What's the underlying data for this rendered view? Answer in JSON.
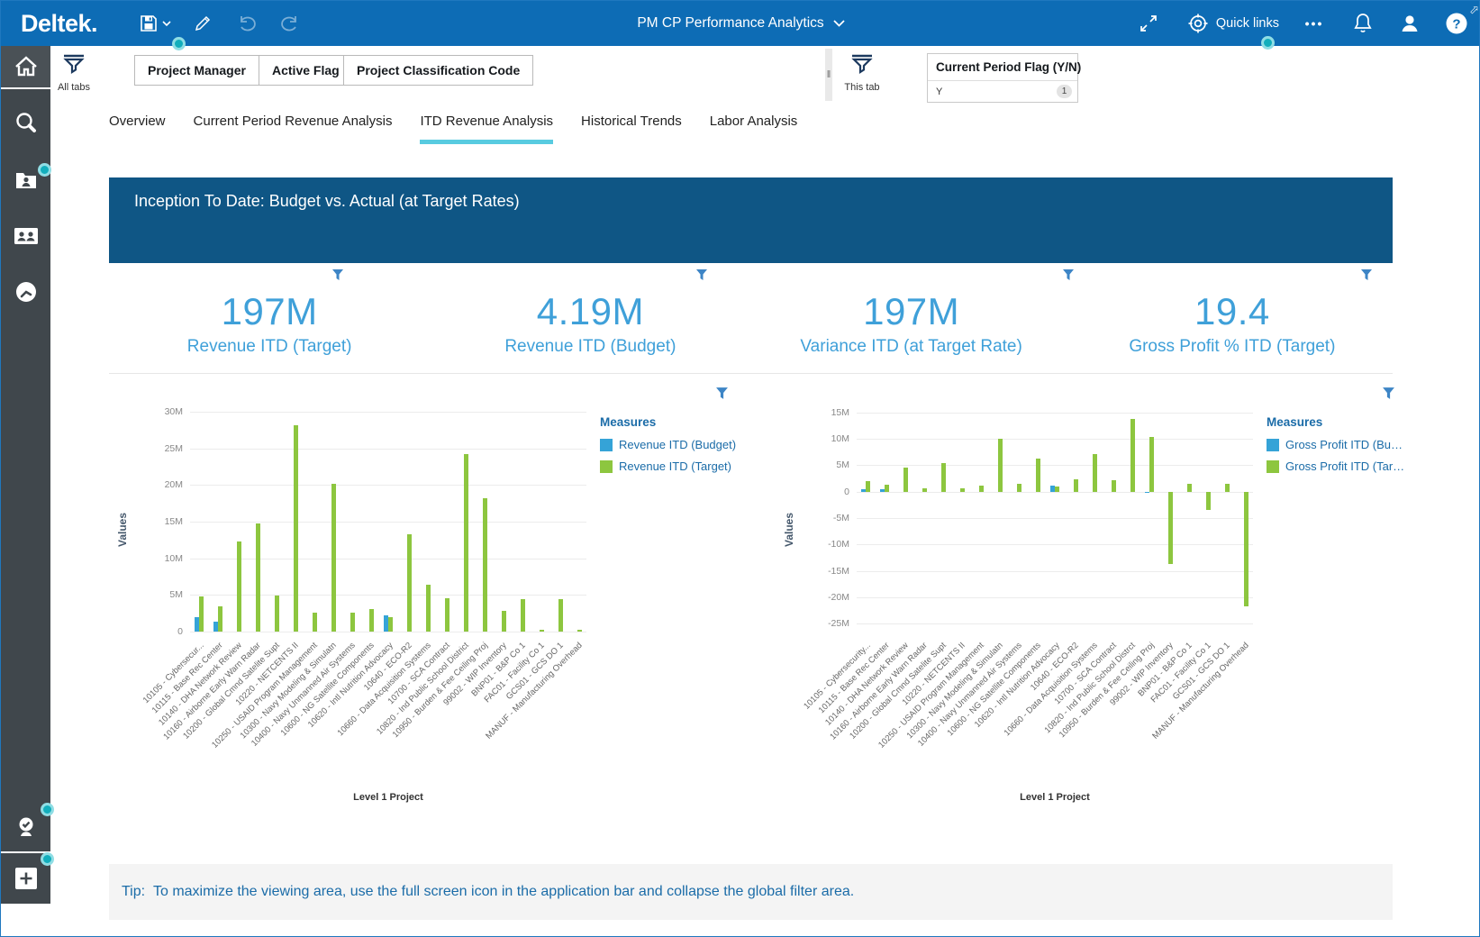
{
  "header": {
    "logo": "Deltek.",
    "title": "PM CP Performance Analytics",
    "quick_links_label": "Quick links",
    "ellipsis_glyph": "•••"
  },
  "filters": {
    "all_tabs_label": "All tabs",
    "this_tab_label": "This tab",
    "buttons": [
      "Project Manager",
      "Active Flag",
      "Project Classification Code"
    ],
    "current_period": {
      "title": "Current Period Flag (Y/N)",
      "value": "Y",
      "count": "1"
    }
  },
  "tabs": [
    "Overview",
    "Current Period Revenue Analysis",
    "ITD Revenue Analysis",
    "Historical Trends",
    "Labor Analysis"
  ],
  "banner": {
    "title": "Inception To Date:  Budget vs. Actual (at Target Rates)"
  },
  "kpis": [
    {
      "value": "197M",
      "label": "Revenue ITD (Target)"
    },
    {
      "value": "4.19M",
      "label": "Revenue ITD (Budget)"
    },
    {
      "value": "197M",
      "label": "Variance ITD (at Target Rate)"
    },
    {
      "value": "19.4",
      "label": "Gross Profit % ITD (Target)"
    }
  ],
  "tip": {
    "prefix": "Tip:",
    "text": "To maximize the viewing area, use the full screen icon in the application bar and collapse the global filter area."
  },
  "colors": {
    "header_blue": "#0d6cb5",
    "banner_blue": "#0f5685",
    "accent_cyan": "#58cbe0",
    "kpi_blue": "#3fa0d9",
    "legend_blue": "#1b6ca8",
    "bar_green": "#8dc63f",
    "bar_blue": "#35a3d7",
    "sidebar_gray": "#40474c",
    "hint_teal": "#12aebc"
  },
  "chart_data": [
    {
      "type": "bar",
      "legend_title": "Measures",
      "legend_position": "right",
      "xlabel": "Level 1 Project",
      "ylabel": "Values",
      "ylim": [
        0,
        31
      ],
      "yticks": [
        0,
        5,
        10,
        15,
        20,
        25,
        30
      ],
      "grid": true,
      "categories": [
        "10105 - Cybersecur...",
        "10115 - Base Rec Center",
        "10140 - DHA Network Review",
        "10160 - Airborne Early Warn Radar",
        "10200 - Global Cmnd Satelite Supt",
        "10220 - NETCENTS II",
        "10250 - USAID Program Management",
        "10300 - Navy Modeling & Simulatn",
        "10400 - Navy Unmanned Air Systems",
        "10600 - NG Satellite Components",
        "10620 - Intl Nutrition Advocacy",
        "10640 - ECO-R2",
        "10660 - Data Acquisition Systems",
        "10700 - SCA Contract",
        "10820 - Ind Public School District",
        "10950 - Burden & Fee Ceiling Proj",
        "99002 - WIP Inventory",
        "BNP01 - B&P Co 1",
        "FAC01 - Facility Co 1",
        "GCS01 - GCS DO 1",
        "MANUF - Manufacturing Overhead"
      ],
      "series": [
        {
          "name": "Revenue ITD (Budget)",
          "color": "#35a3d7",
          "values": [
            2.0,
            1.3,
            0,
            0,
            0,
            0,
            0,
            0,
            0,
            0,
            2.2,
            0,
            0,
            0,
            0,
            0,
            0,
            0,
            0,
            0,
            0
          ]
        },
        {
          "name": "Revenue ITD (Target)",
          "color": "#8dc63f",
          "values": [
            4.8,
            3.4,
            12.3,
            14.8,
            4.9,
            28.2,
            2.6,
            20.2,
            2.6,
            3.1,
            2.0,
            13.3,
            6.4,
            4.6,
            24.2,
            18.2,
            2.8,
            4.4,
            0.3,
            4.4,
            0.3
          ]
        }
      ]
    },
    {
      "type": "bar",
      "legend_title": "Measures",
      "legend_position": "right",
      "xlabel": "Level 1 Project",
      "ylabel": "Values",
      "ylim": [
        -26.5,
        16.5
      ],
      "yticks": [
        -25,
        -20,
        -15,
        -10,
        -5,
        0,
        5,
        10,
        15
      ],
      "grid": true,
      "categories": [
        "10105 - Cybersecurity...",
        "10115 - Base Rec Center",
        "10140 - DHA Network Review",
        "10160 - Airborne Early Warn Radar",
        "10200 - Global Cmnd Satelite Supt",
        "10220 - NETCENTS II",
        "10250 - USAID Program Management",
        "10300 - Navy Modeling & Simulatn",
        "10400 - Navy Unmanned Air Systems",
        "10600 - NG Satellite Components",
        "10620 - Intl Nutrition Advocacy",
        "10640 - ECO-R2",
        "10660 - Data Acquisition Systems",
        "10700 - SCA Contract",
        "10820 - Ind Public School Distrct",
        "10950 - Burden & Fee Ceiling Proj",
        "99002 - WIP Inventory",
        "BNP01 - B&P Co 1",
        "FAC01 - Facility Co 1",
        "GCS01 - GCS DO 1",
        "MANUF - Manufacturing Overhead"
      ],
      "series": [
        {
          "name": "Gross Profit ITD (Bu…",
          "color": "#35a3d7",
          "values": [
            0.5,
            0.4,
            0,
            0,
            0,
            0,
            0,
            0,
            0,
            0,
            1.2,
            0,
            0,
            0,
            0,
            -0.3,
            0,
            0,
            0,
            0,
            0
          ]
        },
        {
          "name": "Gross Profit ITD (Tar…",
          "color": "#8dc63f",
          "values": [
            2.0,
            1.3,
            4.6,
            0.7,
            5.4,
            0.6,
            1.2,
            10.1,
            1.4,
            6.3,
            1.0,
            2.3,
            7.1,
            2.1,
            13.8,
            10.3,
            -13.7,
            1.5,
            -3.4,
            1.4,
            -21.8
          ]
        }
      ]
    }
  ]
}
